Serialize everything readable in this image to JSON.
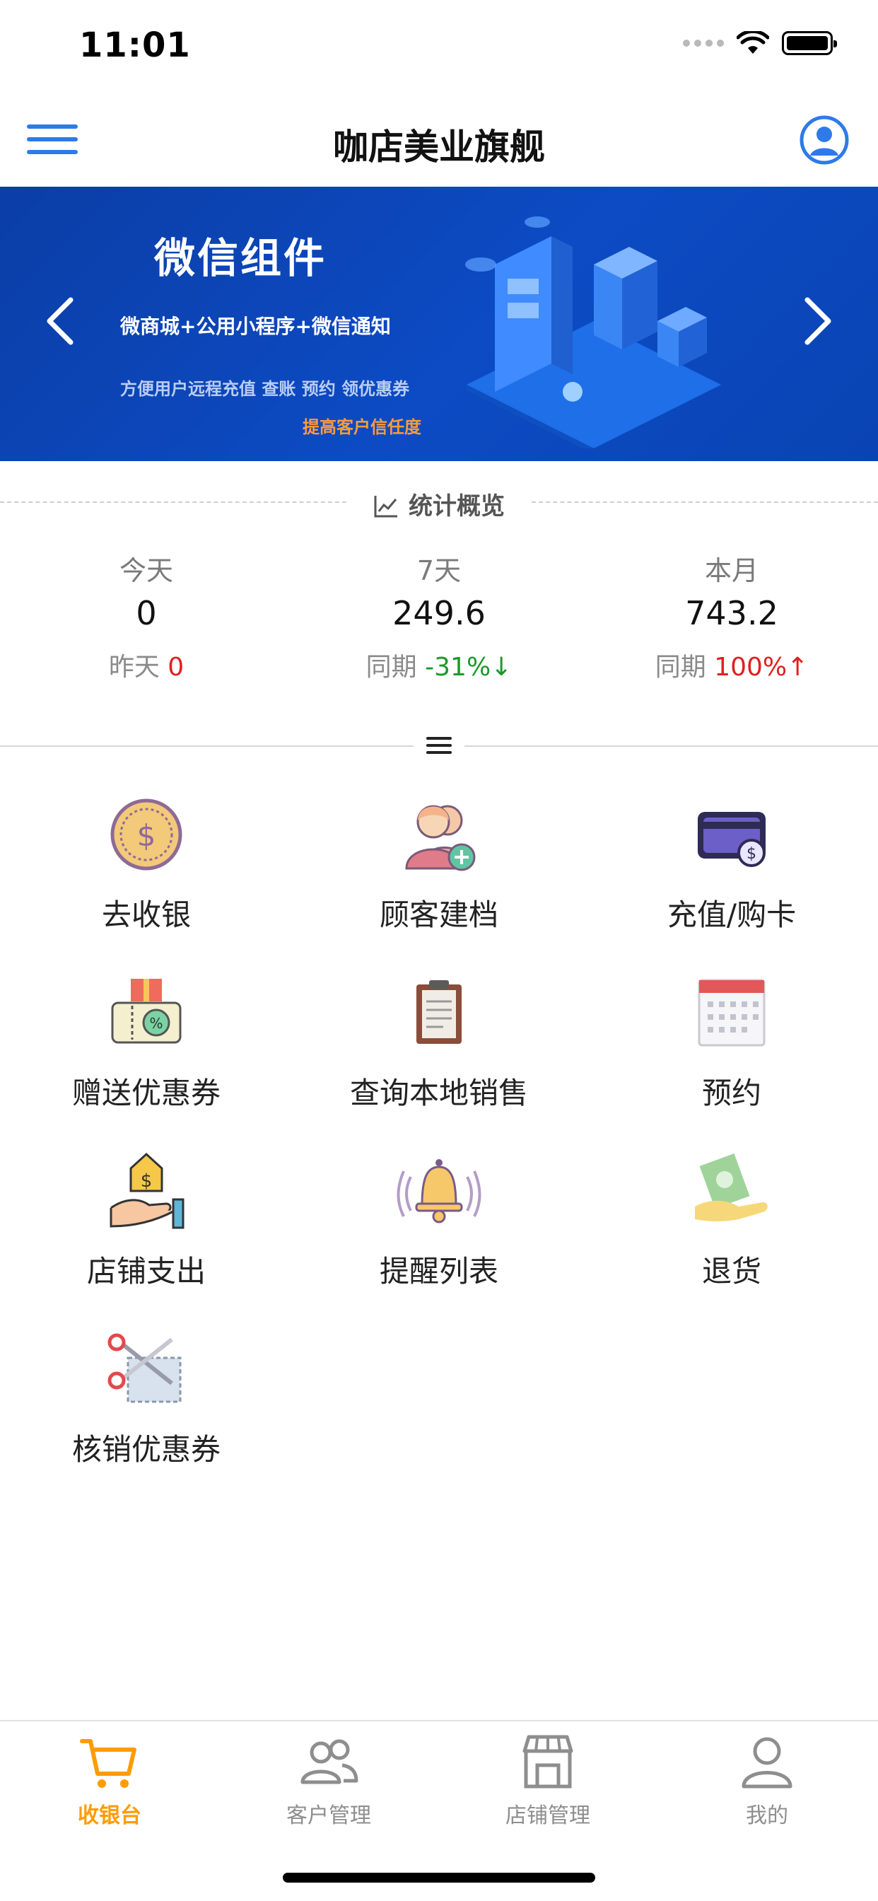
{
  "status_bar": {
    "time": "11:01"
  },
  "nav": {
    "title": "咖店美业旗舰"
  },
  "banner": {
    "title": "微信组件",
    "subtitle": "微商城+公用小程序+微信通知",
    "description": "方便用户远程充值 查账 预约 领优惠券",
    "cta": "提高客户信任度",
    "bg_color": "#0c46b8",
    "cta_color": "#ff9a3a"
  },
  "stats": {
    "title": "统计概览",
    "columns": [
      {
        "label": "今天",
        "value": "0",
        "compare_label": "昨天",
        "compare_value": "0"
      },
      {
        "label": "7天",
        "value": "249.6",
        "compare_label": "同期",
        "compare_value": "-31%↓"
      },
      {
        "label": "本月",
        "value": "743.2",
        "compare_label": "同期",
        "compare_value": "100%↑"
      }
    ]
  },
  "grid": {
    "items": [
      {
        "label": "去收银",
        "icon": "coin-icon"
      },
      {
        "label": "顾客建档",
        "icon": "add-customer-icon"
      },
      {
        "label": "充值/购卡",
        "icon": "card-icon"
      },
      {
        "label": "赠送优惠券",
        "icon": "gift-coupon-icon"
      },
      {
        "label": "查询本地销售",
        "icon": "clipboard-icon"
      },
      {
        "label": "预约",
        "icon": "calendar-icon"
      },
      {
        "label": "店铺支出",
        "icon": "hand-money-icon"
      },
      {
        "label": "提醒列表",
        "icon": "bell-icon"
      },
      {
        "label": "退货",
        "icon": "hand-cash-icon"
      },
      {
        "label": "核销优惠券",
        "icon": "scissors-icon"
      }
    ]
  },
  "tab_bar": {
    "tabs": [
      {
        "label": "收银台",
        "icon": "cart-icon",
        "active": true
      },
      {
        "label": "客户管理",
        "icon": "users-icon",
        "active": false
      },
      {
        "label": "店铺管理",
        "icon": "store-icon",
        "active": false
      },
      {
        "label": "我的",
        "icon": "person-icon",
        "active": false
      }
    ],
    "active_color": "#ff9c00"
  }
}
